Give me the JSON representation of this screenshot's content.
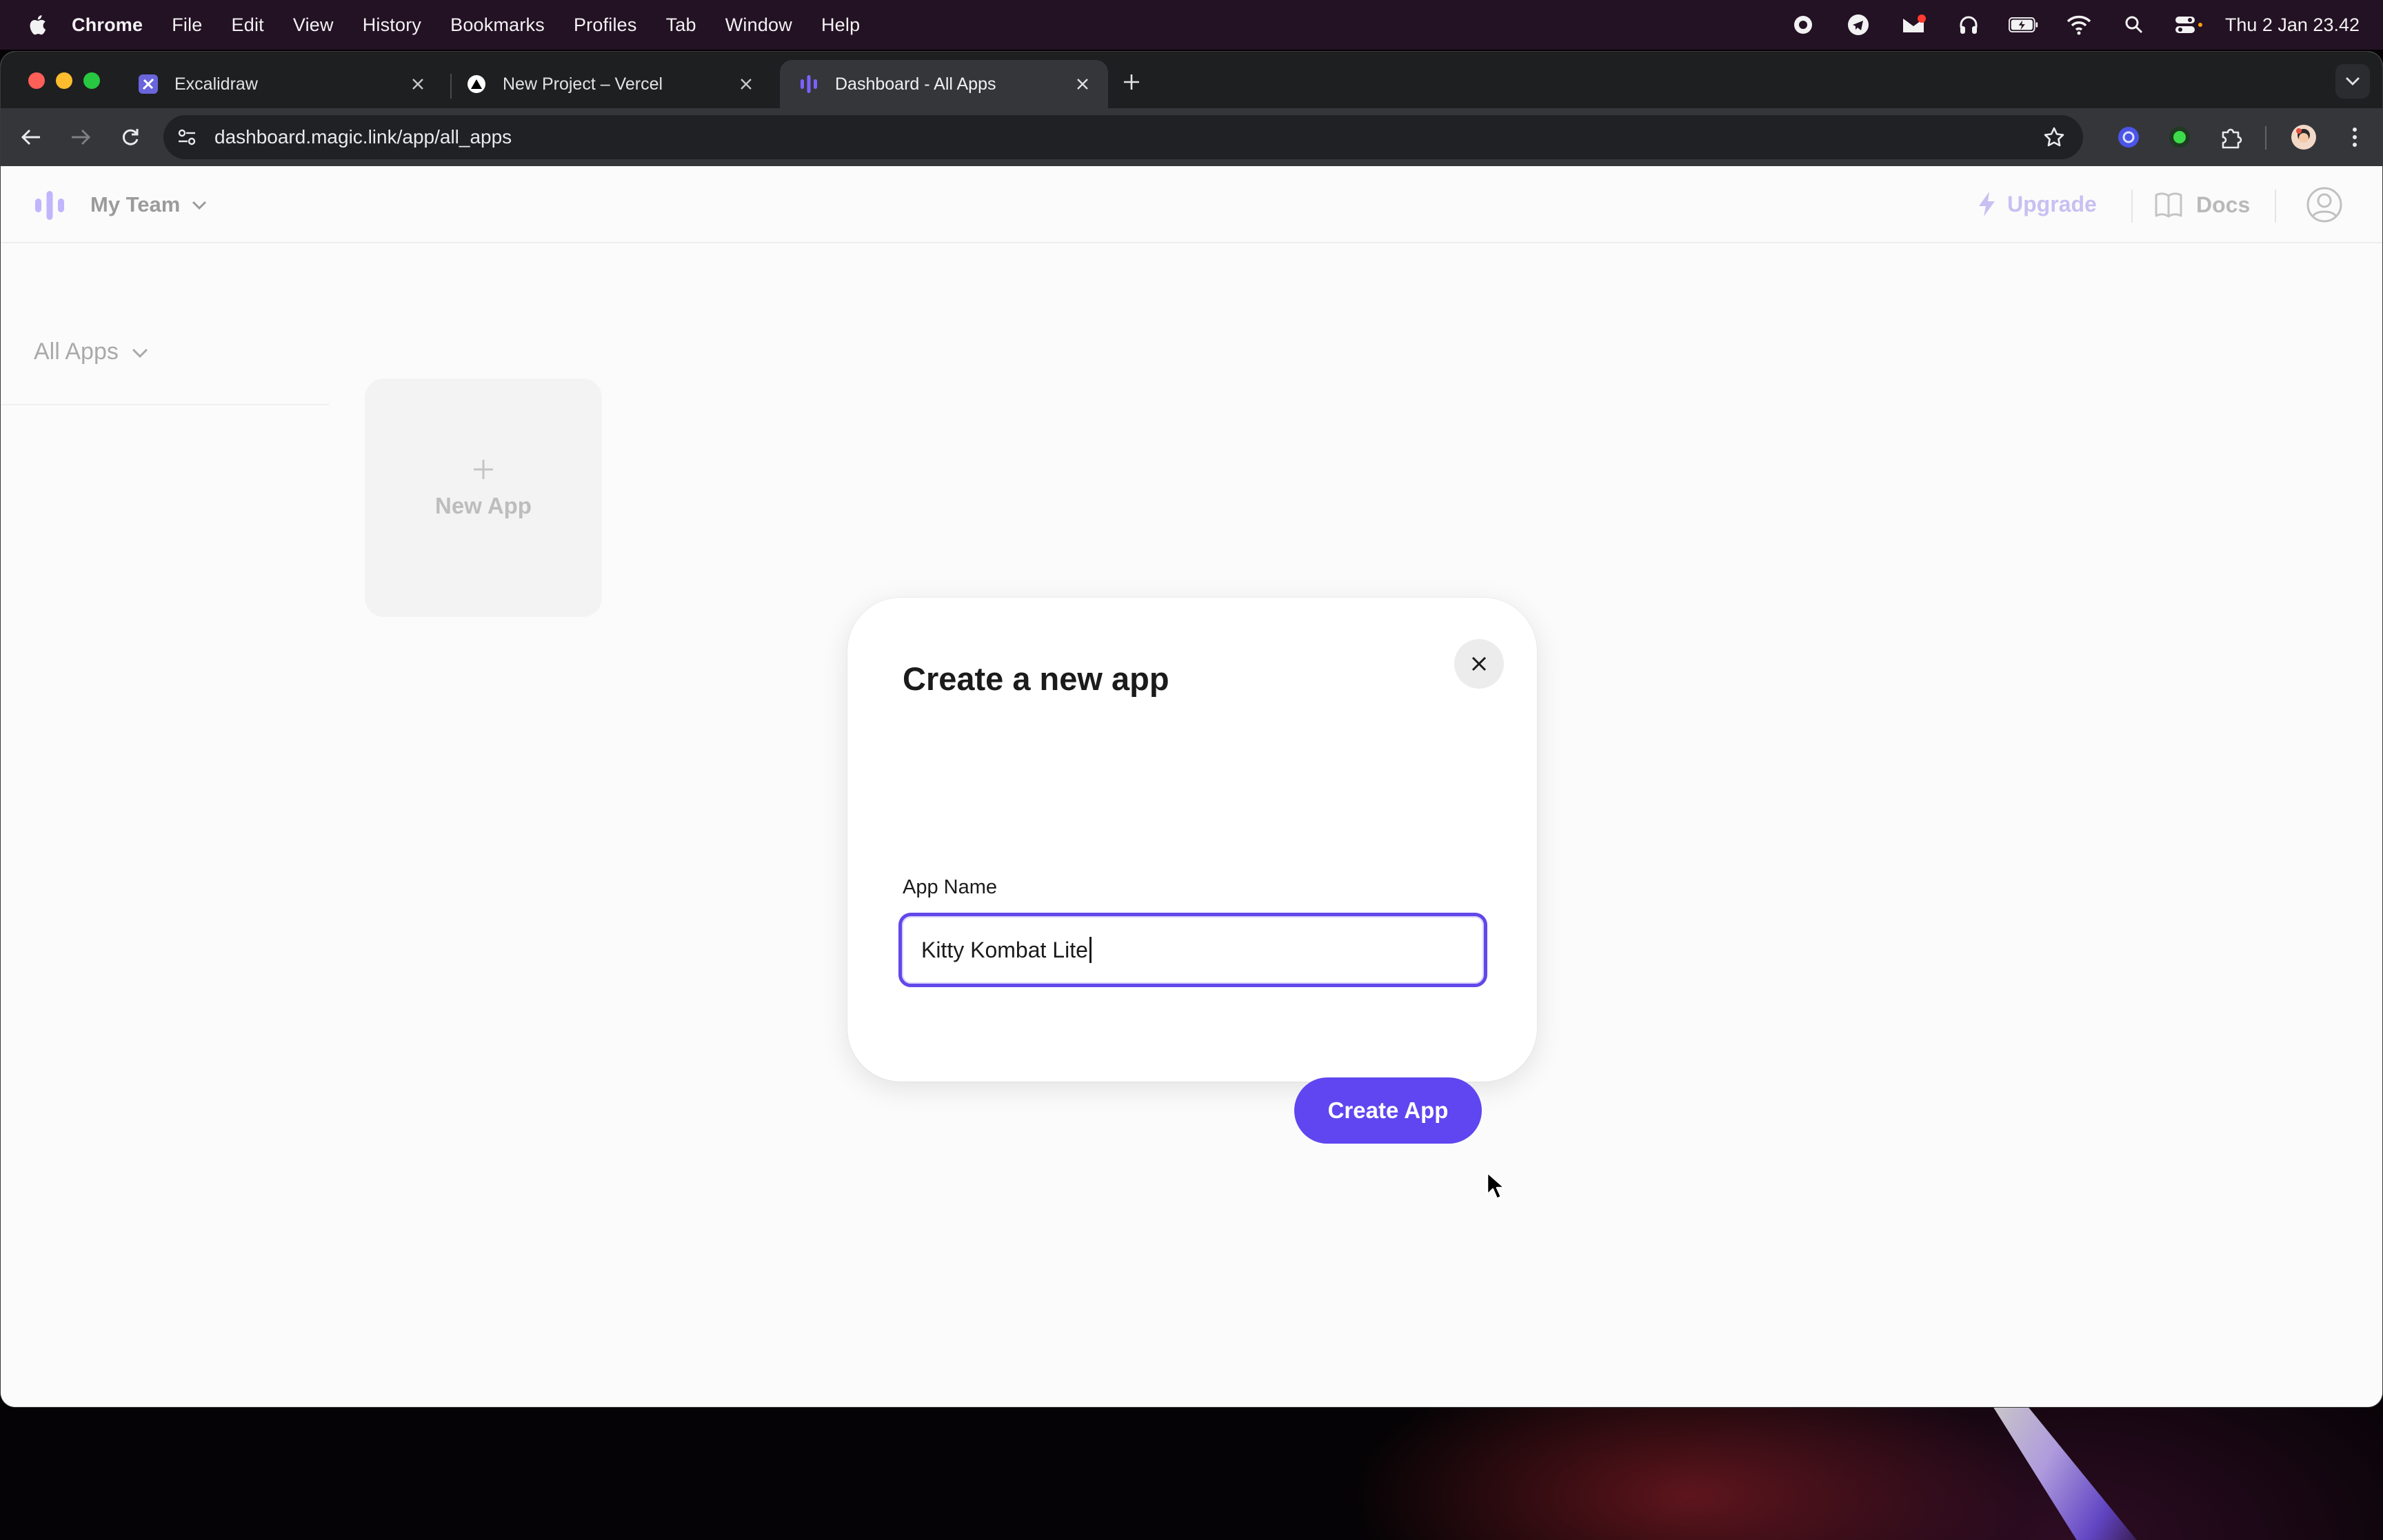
{
  "menubar": {
    "app_name": "Chrome",
    "items": [
      "File",
      "Edit",
      "View",
      "History",
      "Bookmarks",
      "Profiles",
      "Tab",
      "Window",
      "Help"
    ],
    "clock": "Thu 2 Jan  23.42",
    "status_icons": [
      "record-icon",
      "telegram-icon",
      "gmail-icon",
      "headphones-icon",
      "battery-icon",
      "wifi-icon",
      "spotlight-icon",
      "control-center-icon"
    ]
  },
  "browser": {
    "tabs": [
      {
        "title": "Excalidraw",
        "icon": "excalidraw-icon"
      },
      {
        "title": "New Project – Vercel",
        "icon": "vercel-icon"
      },
      {
        "title": "Dashboard - All Apps",
        "icon": "magic-icon",
        "active": true
      }
    ],
    "url": "dashboard.magic.link/app/all_apps"
  },
  "header": {
    "team_name": "My Team",
    "upgrade_label": "Upgrade",
    "docs_label": "Docs"
  },
  "sidebar": {
    "filter_label": "All Apps"
  },
  "main": {
    "new_app_label": "New App"
  },
  "modal": {
    "title": "Create a new app",
    "field_label": "App Name",
    "field_value": "Kitty Kombat Lite",
    "submit_label": "Create App"
  },
  "colors": {
    "accent": "#6046f0",
    "input_focus": "#6247ea",
    "menubar_bg": "#231124",
    "tabstrip_bg": "#1e1f21"
  }
}
